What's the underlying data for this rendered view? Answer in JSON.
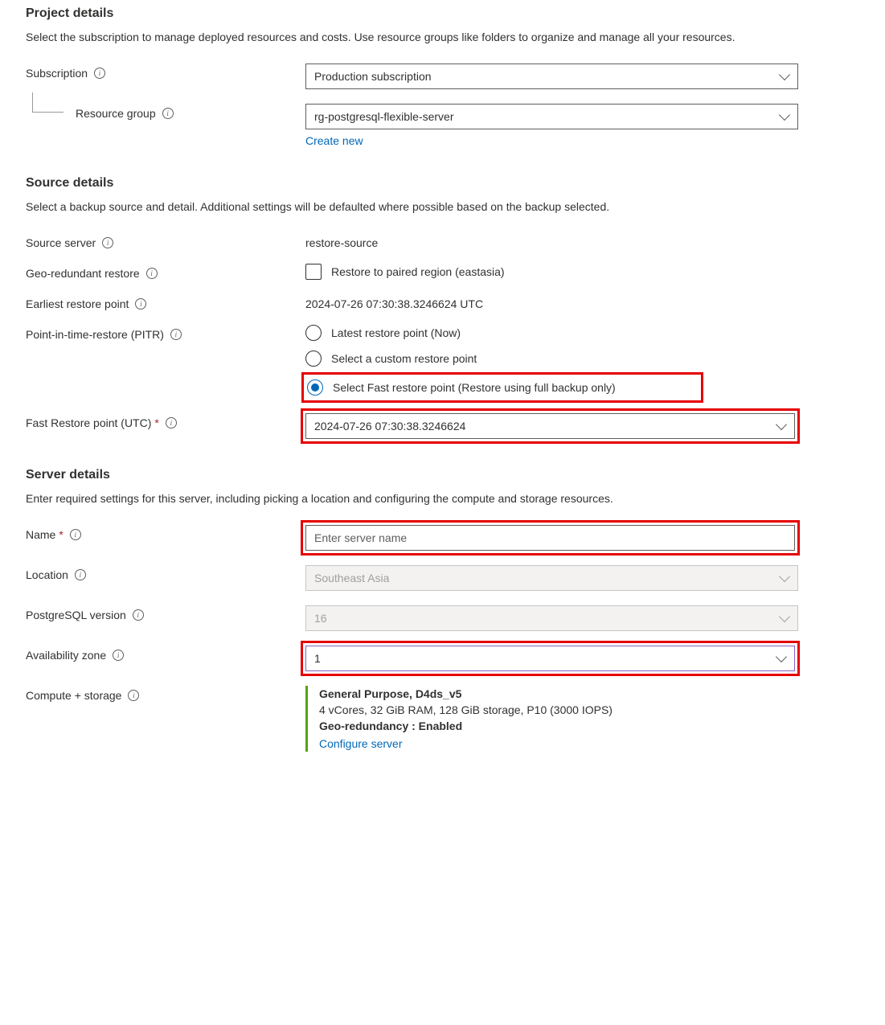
{
  "project": {
    "heading": "Project details",
    "desc": "Select the subscription to manage deployed resources and costs. Use resource groups like folders to organize and manage all your resources.",
    "subscription_label": "Subscription",
    "subscription_value": "Production subscription",
    "resource_group_label": "Resource group",
    "resource_group_value": "rg-postgresql-flexible-server",
    "create_new": "Create new"
  },
  "source": {
    "heading": "Source details",
    "desc": "Select a backup source and detail. Additional settings will be defaulted where possible based on the backup selected.",
    "source_server_label": "Source server",
    "source_server_value": "restore-source",
    "geo_label": "Geo-redundant restore",
    "geo_checkbox_label": "Restore to paired region (eastasia)",
    "earliest_label": "Earliest restore point",
    "earliest_value": "2024-07-26 07:30:38.3246624 UTC",
    "pitr_label": "Point-in-time-restore (PITR)",
    "pitr_options": {
      "latest": "Latest restore point (Now)",
      "custom": "Select a custom restore point",
      "fast": "Select Fast restore point (Restore using full backup only)"
    },
    "fast_label": "Fast Restore point (UTC)",
    "fast_value": "2024-07-26 07:30:38.3246624"
  },
  "server": {
    "heading": "Server details",
    "desc": "Enter required settings for this server, including picking a location and configuring the compute and storage resources.",
    "name_label": "Name",
    "name_placeholder": "Enter server name",
    "location_label": "Location",
    "location_value": "Southeast Asia",
    "pg_label": "PostgreSQL version",
    "pg_value": "16",
    "az_label": "Availability zone",
    "az_value": "1",
    "compute_label": "Compute + storage",
    "compute_line1": "General Purpose, D4ds_v5",
    "compute_line2": "4 vCores, 32 GiB RAM, 128 GiB storage, P10 (3000 IOPS)",
    "compute_line3": "Geo-redundancy : Enabled",
    "configure_link": "Configure server"
  }
}
